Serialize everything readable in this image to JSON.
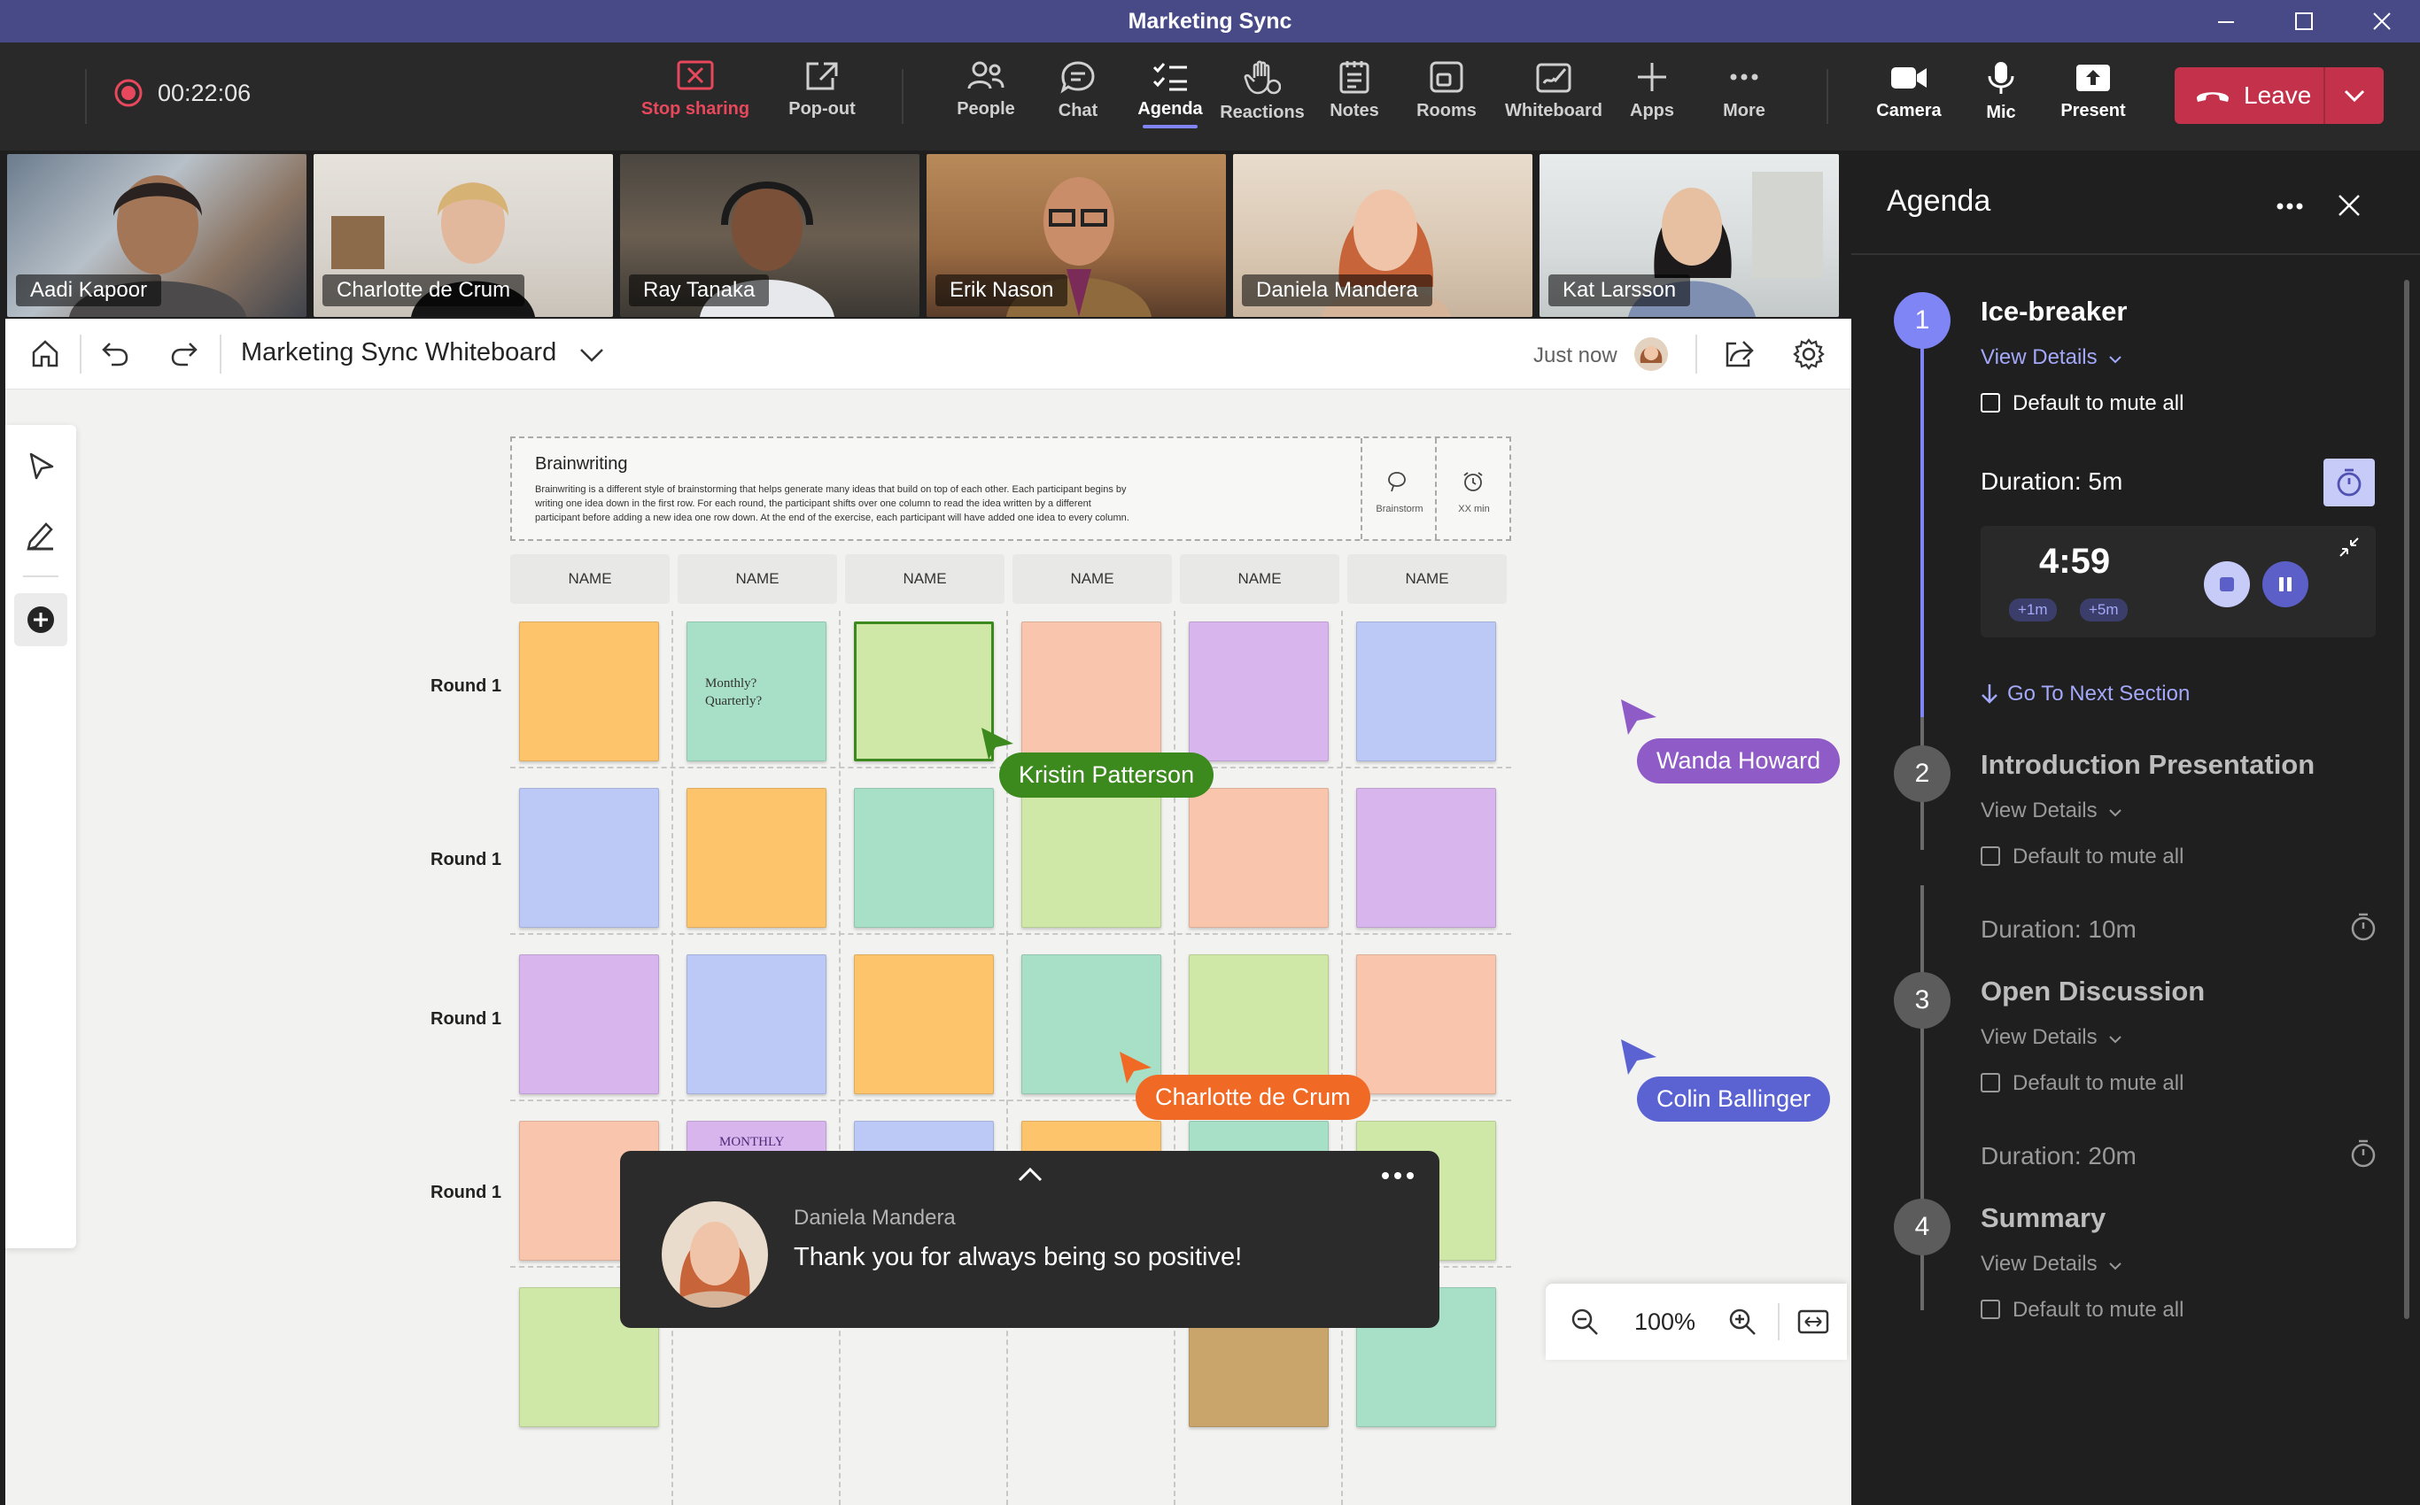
{
  "window": {
    "title": "Marketing Sync"
  },
  "toolbar": {
    "recording_time": "00:22:06",
    "stop_sharing": "Stop sharing",
    "pop_out": "Pop-out",
    "people": "People",
    "chat": "Chat",
    "agenda": "Agenda",
    "reactions": "Reactions",
    "notes": "Notes",
    "rooms": "Rooms",
    "whiteboard": "Whiteboard",
    "apps": "Apps",
    "more": "More",
    "camera": "Camera",
    "mic": "Mic",
    "present": "Present",
    "leave": "Leave",
    "colors": {
      "leave": "#c4314b",
      "stop_sharing": "#e8485c",
      "accent": "#7f85f5"
    }
  },
  "participants": [
    {
      "name": "Aadi Kapoor"
    },
    {
      "name": "Charlotte de Crum"
    },
    {
      "name": "Ray Tanaka"
    },
    {
      "name": "Erik Nason"
    },
    {
      "name": "Daniela Mandera"
    },
    {
      "name": "Kat Larsson"
    }
  ],
  "whiteboard": {
    "title": "Marketing Sync Whiteboard",
    "saved_status": "Just now",
    "template": {
      "title": "Brainwriting",
      "description_lines": [
        "Brainwriting is a different style of brainstorming that helps generate many ideas that build on top of each other. Each participant begins by",
        "writing one idea down in the first row. For each round, the participant shifts over one column to read the idea written by a different",
        "participant before adding a new idea one row down. At the end of the exercise, each participant will have added one idea to every column."
      ],
      "brainstorm_label": "Brainstorm",
      "time_label": "XX min"
    },
    "columns": [
      "NAME",
      "NAME",
      "NAME",
      "NAME",
      "NAME",
      "NAME"
    ],
    "rounds": [
      "Round 1",
      "Round 1",
      "Round 1",
      "Round 1"
    ],
    "note_text_1": "Monthly?",
    "note_text_2": "Quarterly?",
    "note_text_3": "MONTHLY",
    "cursors": [
      {
        "name": "Kristin Patterson",
        "color": "#3c8a1e"
      },
      {
        "name": "Wanda Howard",
        "color": "#8e5bc7"
      },
      {
        "name": "Charlotte de Crum",
        "color": "#f06a25"
      },
      {
        "name": "Colin Ballinger",
        "color": "#5b63d3"
      }
    ],
    "zoom_level": "100%"
  },
  "toast": {
    "sender": "Daniela Mandera",
    "message": "Thank you for always being so positive!"
  },
  "agenda": {
    "title": "Agenda",
    "items": [
      {
        "number": "1",
        "title": "Ice-breaker",
        "view_details": "View Details",
        "mute_label": "Default to mute all",
        "duration": "Duration: 5m"
      },
      {
        "number": "2",
        "title": "Introduction Presentation",
        "view_details": "View Details",
        "mute_label": "Default to mute all",
        "duration": "Duration: 10m"
      },
      {
        "number": "3",
        "title": "Open Discussion",
        "view_details": "View Details",
        "mute_label": "Default to mute all",
        "duration": "Duration: 20m"
      },
      {
        "number": "4",
        "title": "Summary",
        "view_details": "View Details",
        "mute_label": "Default to mute all"
      }
    ],
    "timer": {
      "remaining": "4:59",
      "add_1": "+1m",
      "add_5": "+5m"
    },
    "next_section": "Go To Next Section"
  }
}
